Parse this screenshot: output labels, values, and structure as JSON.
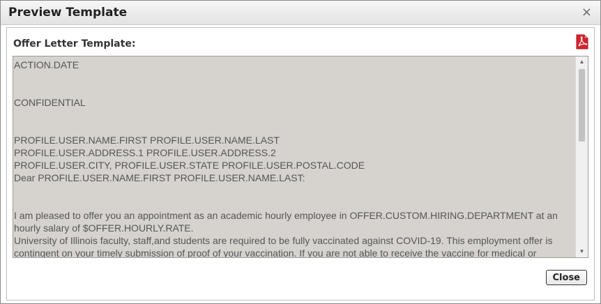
{
  "dialog": {
    "title": "Preview Template",
    "close_glyph": "×"
  },
  "section": {
    "label": "Offer Letter Template:",
    "pdf_icon": "pdf-icon",
    "pdf_color": "#d9232a"
  },
  "template_text": {
    "lines": [
      "ACTION.DATE",
      "",
      "CONFIDENTIAL",
      "",
      "PROFILE.USER.NAME.FIRST PROFILE.USER.NAME.LAST",
      "PROFILE.USER.ADDRESS.1 PROFILE.USER.ADDRESS.2",
      "PROFILE.USER.CITY, PROFILE.USER.STATE PROFILE.USER.POSTAL.CODE",
      "Dear PROFILE.USER.NAME.FIRST PROFILE.USER.NAME.LAST:",
      "",
      "I am pleased to offer you an appointment as an academic hourly employee in OFFER.CUSTOM.HIRING.DEPARTMENT at an hourly salary of $OFFER.HOURLY.RATE.",
      "University of Illinois faculty, staff,and students are required to be fully vaccinated against COVID-19. This employment offer is contingent on your timely submission of proof of your vaccination. If you are not able to receive the vaccine for medical or religious reasons, you may seek approval for an exemption in accordance with applicable University processes."
    ],
    "background": "#d6d3ce"
  },
  "scrollbar": {
    "up_glyph": "▲",
    "down_glyph": "▼"
  },
  "buttons": {
    "close_label": "Close"
  }
}
